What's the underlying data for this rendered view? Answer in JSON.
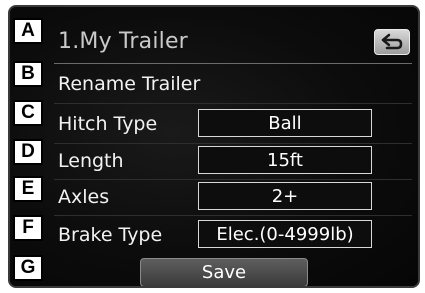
{
  "screen": {
    "title": "1.My Trailer"
  },
  "items": [
    {
      "label": "Rename Trailer"
    },
    {
      "label": "Hitch Type",
      "value": "Ball"
    },
    {
      "label": "Length",
      "value": "15ft"
    },
    {
      "label": "Axles",
      "value": "2+"
    },
    {
      "label": "Brake Type",
      "value": "Elec.(0-4999lb)"
    }
  ],
  "save_label": "Save",
  "callouts": [
    "A",
    "B",
    "C",
    "D",
    "E",
    "F",
    "G"
  ],
  "icons": {
    "back": "back-arrow-icon"
  }
}
